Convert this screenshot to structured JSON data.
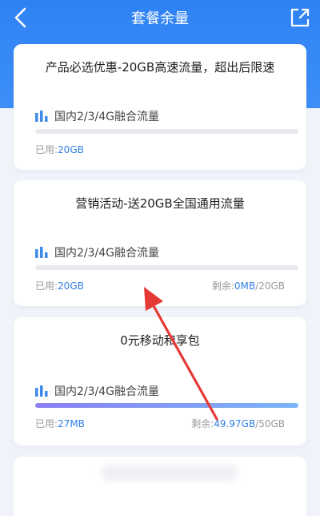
{
  "nav": {
    "title": "套餐余量",
    "back_icon": "chevron-left-icon",
    "share_icon": "share-external-icon"
  },
  "colors": {
    "header_blue": "#2f82f4",
    "value_blue": "#2f7ee5",
    "bar_gradient_start": "#8a7ff2",
    "bar_gradient_end": "#7bb6f5",
    "track_gray": "#e8eaee",
    "arrow_red": "#e53935"
  },
  "cards": [
    {
      "title": "产品必选优惠-20GB高速流量，超出后限速",
      "label": "国内2/3/4G融合流量",
      "used_prefix": "已用:",
      "used_value": "20GB",
      "progress": 0
    },
    {
      "title": "营销活动-送20GB全国通用流量",
      "label": "国内2/3/4G融合流量",
      "used_prefix": "已用:",
      "used_value": "20GB",
      "remain_prefix": "剩余:",
      "remain_value": "0MB",
      "remain_total": "/20GB",
      "progress": 0
    },
    {
      "title": "0元移动和享包",
      "label": "国内2/3/4G融合流量",
      "used_prefix": "已用:",
      "used_value": "27MB",
      "remain_prefix": "剩余:",
      "remain_value": "49.97GB",
      "remain_total": "/50GB",
      "progress": 0.9995
    }
  ]
}
